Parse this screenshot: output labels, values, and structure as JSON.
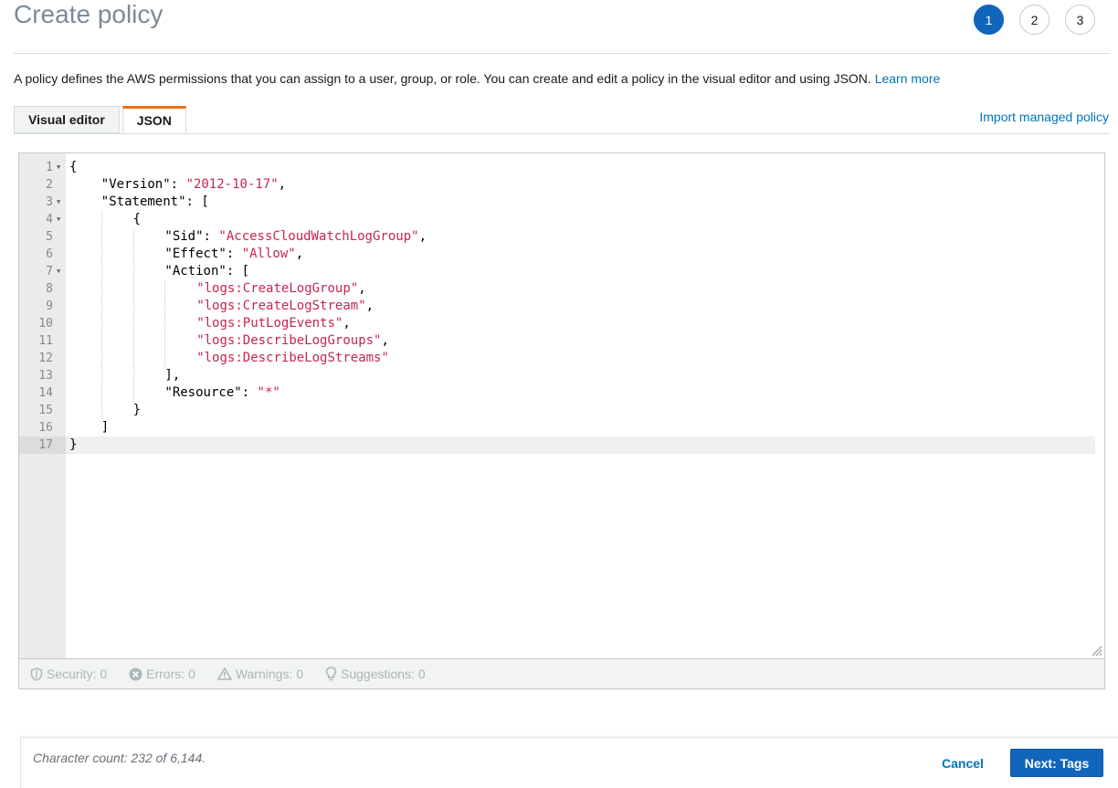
{
  "page": {
    "title": "Create policy",
    "steps": [
      "1",
      "2",
      "3"
    ],
    "active_step": "1",
    "description": "A policy defines the AWS permissions that you can assign to a user, group, or role. You can create and edit a policy in the visual editor and using JSON.",
    "learn_more": "Learn more"
  },
  "tabs": [
    {
      "label": "Visual editor",
      "active": false
    },
    {
      "label": "JSON",
      "active": true
    }
  ],
  "import_link": "Import managed policy",
  "editor": {
    "current_line": 17,
    "lines": [
      {
        "n": "1",
        "fold": true,
        "tokens": [
          {
            "t": "{",
            "c": "p"
          }
        ]
      },
      {
        "n": "2",
        "fold": false,
        "indent": 1,
        "tokens": [
          {
            "t": "\"Version\"",
            "c": "key"
          },
          {
            "t": ": ",
            "c": "p"
          },
          {
            "t": "\"2012-10-17\"",
            "c": "str"
          },
          {
            "t": ",",
            "c": "p"
          }
        ]
      },
      {
        "n": "3",
        "fold": true,
        "indent": 1,
        "tokens": [
          {
            "t": "\"Statement\"",
            "c": "key"
          },
          {
            "t": ": [",
            "c": "p"
          }
        ]
      },
      {
        "n": "4",
        "fold": true,
        "indent": 2,
        "tokens": [
          {
            "t": "{",
            "c": "p"
          }
        ]
      },
      {
        "n": "5",
        "fold": false,
        "indent": 3,
        "tokens": [
          {
            "t": "\"Sid\"",
            "c": "key"
          },
          {
            "t": ": ",
            "c": "p"
          },
          {
            "t": "\"AccessCloudWatchLogGroup\"",
            "c": "str"
          },
          {
            "t": ",",
            "c": "p"
          }
        ]
      },
      {
        "n": "6",
        "fold": false,
        "indent": 3,
        "tokens": [
          {
            "t": "\"Effect\"",
            "c": "key"
          },
          {
            "t": ": ",
            "c": "p"
          },
          {
            "t": "\"Allow\"",
            "c": "str"
          },
          {
            "t": ",",
            "c": "p"
          }
        ]
      },
      {
        "n": "7",
        "fold": true,
        "indent": 3,
        "tokens": [
          {
            "t": "\"Action\"",
            "c": "key"
          },
          {
            "t": ": [",
            "c": "p"
          }
        ]
      },
      {
        "n": "8",
        "fold": false,
        "indent": 4,
        "tokens": [
          {
            "t": "\"logs:CreateLogGroup\"",
            "c": "str"
          },
          {
            "t": ",",
            "c": "p"
          }
        ]
      },
      {
        "n": "9",
        "fold": false,
        "indent": 4,
        "tokens": [
          {
            "t": "\"logs:CreateLogStream\"",
            "c": "str"
          },
          {
            "t": ",",
            "c": "p"
          }
        ]
      },
      {
        "n": "10",
        "fold": false,
        "indent": 4,
        "tokens": [
          {
            "t": "\"logs:PutLogEvents\"",
            "c": "str"
          },
          {
            "t": ",",
            "c": "p"
          }
        ]
      },
      {
        "n": "11",
        "fold": false,
        "indent": 4,
        "tokens": [
          {
            "t": "\"logs:DescribeLogGroups\"",
            "c": "str"
          },
          {
            "t": ",",
            "c": "p"
          }
        ]
      },
      {
        "n": "12",
        "fold": false,
        "indent": 4,
        "tokens": [
          {
            "t": "\"logs:DescribeLogStreams\"",
            "c": "str"
          }
        ]
      },
      {
        "n": "13",
        "fold": false,
        "indent": 3,
        "tokens": [
          {
            "t": "],",
            "c": "p"
          }
        ]
      },
      {
        "n": "14",
        "fold": false,
        "indent": 3,
        "tokens": [
          {
            "t": "\"Resource\"",
            "c": "key"
          },
          {
            "t": ": ",
            "c": "p"
          },
          {
            "t": "\"*\"",
            "c": "str"
          }
        ]
      },
      {
        "n": "15",
        "fold": false,
        "indent": 2,
        "tokens": [
          {
            "t": "}",
            "c": "p"
          }
        ]
      },
      {
        "n": "16",
        "fold": false,
        "indent": 1,
        "tokens": [
          {
            "t": "]",
            "c": "p"
          }
        ]
      },
      {
        "n": "17",
        "fold": false,
        "indent": 0,
        "tokens": [
          {
            "t": "}",
            "c": "p"
          }
        ]
      }
    ]
  },
  "status": {
    "security": "Security: 0",
    "errors": "Errors: 0",
    "warnings": "Warnings: 0",
    "suggestions": "Suggestions: 0"
  },
  "footer": {
    "char_count": "Character count: 232 of 6,144.",
    "cancel": "Cancel",
    "next": "Next: Tags"
  },
  "colors": {
    "primary": "#1166bb",
    "link": "#0073bb",
    "tab_accent": "#ec7211",
    "string": "#c7254e"
  }
}
